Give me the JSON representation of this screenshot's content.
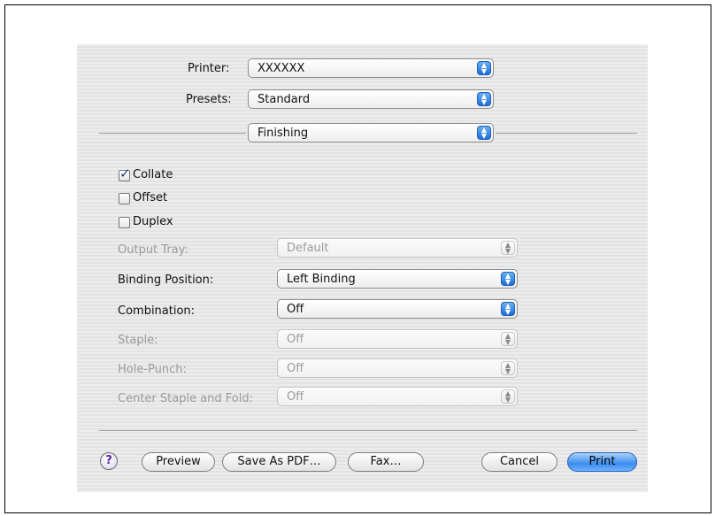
{
  "printer": {
    "label": "Printer:",
    "value": "XXXXXX"
  },
  "presets": {
    "label": "Presets:",
    "value": "Standard"
  },
  "pane": {
    "value": "Finishing"
  },
  "checkboxes": [
    {
      "label": "Collate",
      "checked": true
    },
    {
      "label": "Offset",
      "checked": false
    },
    {
      "label": "Duplex",
      "checked": false
    }
  ],
  "fields": [
    {
      "label": "Output Tray:",
      "value": "Default",
      "enabled": false
    },
    {
      "label": "Binding Position:",
      "value": "Left Binding",
      "enabled": true
    },
    {
      "label": "Combination:",
      "value": "Off",
      "enabled": true
    },
    {
      "label": "Staple:",
      "value": "Off",
      "enabled": false
    },
    {
      "label": "Hole-Punch:",
      "value": "Off",
      "enabled": false
    },
    {
      "label": "Center Staple and Fold:",
      "value": "Off",
      "enabled": false
    }
  ],
  "buttons": {
    "help": "?",
    "preview": "Preview",
    "save_pdf": "Save As PDF…",
    "fax": "Fax…",
    "cancel": "Cancel",
    "print": "Print"
  },
  "icons": {
    "popup_arrow": "up-down-arrows-icon",
    "help": "help-question-icon",
    "check": "checkmark-icon"
  }
}
